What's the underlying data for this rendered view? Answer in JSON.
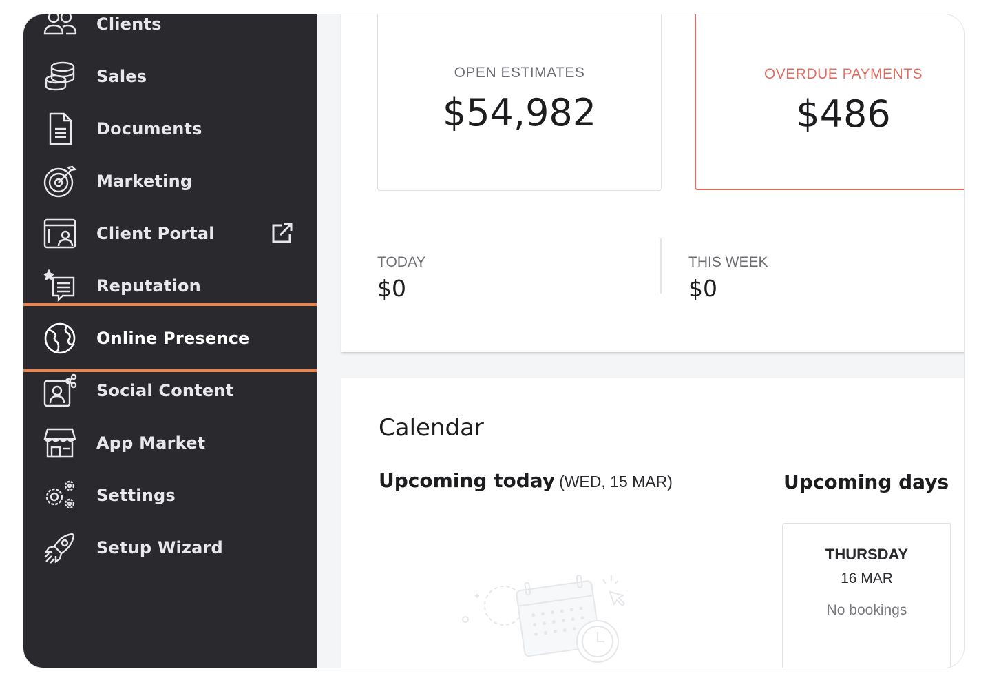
{
  "sidebar": {
    "items": [
      {
        "label": "Clients",
        "icon": "clients-icon"
      },
      {
        "label": "Sales",
        "icon": "coins-icon"
      },
      {
        "label": "Documents",
        "icon": "document-icon"
      },
      {
        "label": "Marketing",
        "icon": "target-icon"
      },
      {
        "label": "Client Portal",
        "icon": "portal-icon",
        "external": "external-link-icon"
      },
      {
        "label": "Reputation",
        "icon": "reputation-icon"
      },
      {
        "label": "Online Presence",
        "icon": "globe-icon",
        "active": true
      },
      {
        "label": "Social Content",
        "icon": "social-content-icon"
      },
      {
        "label": "App Market",
        "icon": "store-icon"
      },
      {
        "label": "Settings",
        "icon": "gears-icon"
      },
      {
        "label": "Setup Wizard",
        "icon": "rocket-icon"
      }
    ],
    "highlight_color": "#e9834d"
  },
  "stats": {
    "open_estimates": {
      "caption": "OPEN ESTIMATES",
      "value": "$54,982"
    },
    "overdue_payments": {
      "caption": "OVERDUE PAYMENTS",
      "value": "$486",
      "color": "#e16d62"
    },
    "today": {
      "caption": "TODAY",
      "value": "$0"
    },
    "this_week": {
      "caption": "THIS WEEK",
      "value": "$0"
    }
  },
  "calendar": {
    "title": "Calendar",
    "upcoming_today_label": "Upcoming today",
    "upcoming_today_date": "(WED,  15 MAR)",
    "upcoming_days_label": "Upcoming days",
    "day_card": {
      "day": "THURSDAY",
      "date": "16 MAR",
      "status": "No bookings"
    }
  }
}
